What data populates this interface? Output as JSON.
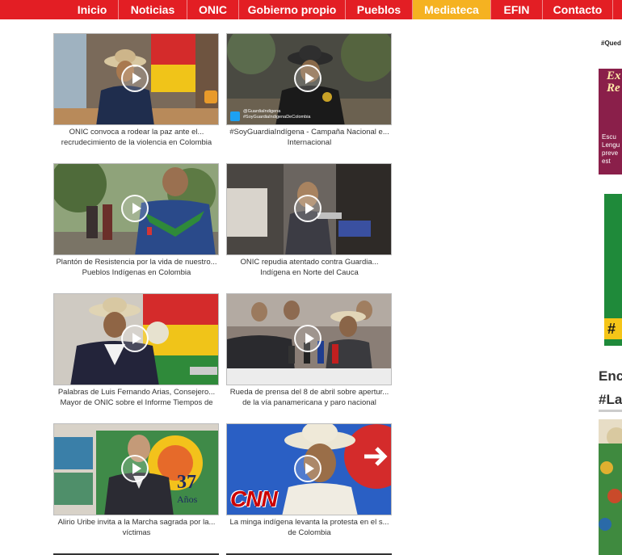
{
  "nav": {
    "items": [
      {
        "label": "Inicio"
      },
      {
        "label": "Noticias"
      },
      {
        "label": "ONIC"
      },
      {
        "label": "Gobierno propio"
      },
      {
        "label": "Pueblos"
      },
      {
        "label": "Mediateca",
        "active": true
      },
      {
        "label": "EFIN"
      },
      {
        "label": "Contacto"
      }
    ],
    "bg_color": "#e31e24",
    "active_color": "#f5b221"
  },
  "videos": [
    {
      "line1": "ONIC convoca a rodear la paz ante el...",
      "line2": "recrudecimiento de la violencia en Colombia"
    },
    {
      "line1": "#SoyGuardiaIndígena - Campaña Nacional e...",
      "line2": "Internacional",
      "overlay": [
        "@GuardiaIndigena",
        "#SoyGuardiaIndigenaDeColombia"
      ]
    },
    {
      "line1": "Plantón de Resistencia por la vida de nuestro...",
      "line2": "Pueblos Indígenas en Colombia"
    },
    {
      "line1": "ONIC repudia atentado contra Guardia...",
      "line2": "Indígena en Norte del Cauca"
    },
    {
      "line1": "Palabras de Luis Fernando Arias, Consejero...",
      "line2": "Mayor de ONIC sobre el Informe Tiempos de"
    },
    {
      "line1": "Rueda de prensa del 8 de abril sobre apertur...",
      "line2": "de la vía panamericana y paro nacional"
    },
    {
      "line1": "Alirio Uribe invita a la Marcha sagrada por la...",
      "line2": "víctimas",
      "overlay": [
        "37",
        "Años"
      ]
    },
    {
      "line1": "La minga indígena levanta la protesta en el s...",
      "line2": "de Colombia",
      "overlay": [
        "CNN"
      ]
    }
  ],
  "sidebar": {
    "hashtag_top": "#Qued",
    "title_1": "Enc",
    "title_2": "#La",
    "banner_ex": [
      "Ex",
      "Re"
    ],
    "banner_text": [
      "Escu",
      "Lengu",
      "preve",
      "est"
    ],
    "hash_badge": "#"
  }
}
